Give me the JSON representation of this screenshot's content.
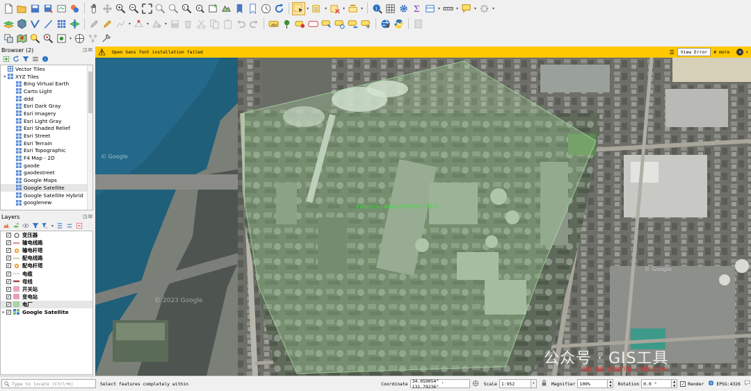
{
  "browser": {
    "title": "Browser (2)",
    "controls": "◳☒",
    "items": [
      {
        "label": "Vector Tiles",
        "expanded": false,
        "indent": 0,
        "icon": "vector-tiles-icon"
      },
      {
        "label": "XYZ Tiles",
        "expanded": true,
        "indent": 0,
        "icon": "xyz-tiles-icon"
      },
      {
        "label": "Bing Virtual Earth",
        "indent": 1,
        "icon": "tile-icon"
      },
      {
        "label": "Carto Light",
        "indent": 1,
        "icon": "tile-icon"
      },
      {
        "label": "ddd",
        "indent": 1,
        "icon": "tile-icon"
      },
      {
        "label": "Esri Dark Gray",
        "indent": 1,
        "icon": "tile-icon"
      },
      {
        "label": "Esri Imagery",
        "indent": 1,
        "icon": "tile-icon"
      },
      {
        "label": "Esri Light Gray",
        "indent": 1,
        "icon": "tile-icon"
      },
      {
        "label": "Esri Shaded Relief",
        "indent": 1,
        "icon": "tile-icon"
      },
      {
        "label": "Esri Street",
        "indent": 1,
        "icon": "tile-icon"
      },
      {
        "label": "Esri Terrain",
        "indent": 1,
        "icon": "tile-icon"
      },
      {
        "label": "Esri Topographic",
        "indent": 1,
        "icon": "tile-icon"
      },
      {
        "label": "F4 Map - 2D",
        "indent": 1,
        "icon": "tile-icon"
      },
      {
        "label": "gaode",
        "indent": 1,
        "icon": "tile-icon"
      },
      {
        "label": "gaodestreet",
        "indent": 1,
        "icon": "tile-icon"
      },
      {
        "label": "Google Maps",
        "indent": 1,
        "icon": "tile-icon"
      },
      {
        "label": "Google Satellite",
        "indent": 1,
        "icon": "tile-icon",
        "selected": true
      },
      {
        "label": "Google Satellite Hybrid",
        "indent": 1,
        "icon": "tile-icon"
      },
      {
        "label": "googlenew",
        "indent": 1,
        "icon": "tile-icon"
      }
    ]
  },
  "layers": {
    "title": "Layers",
    "controls": "◳☒",
    "items": [
      {
        "label": "变压器",
        "symbol": "point-circle",
        "color": "#ffffff",
        "stroke": "#333333"
      },
      {
        "label": "输电线路",
        "symbol": "line",
        "color": "#c0392b"
      },
      {
        "label": "输电杆塔",
        "symbol": "point-dot",
        "color": "#f0a030"
      },
      {
        "label": "配电线路",
        "symbol": "line",
        "color": "#8fbc5a"
      },
      {
        "label": "配电杆塔",
        "symbol": "point-dot",
        "color": "#f0a030"
      },
      {
        "label": "电缆",
        "symbol": "dash-line",
        "color": "#a0a0a0"
      },
      {
        "label": "母线",
        "symbol": "thick-line",
        "color": "#a04040"
      },
      {
        "label": "开关站",
        "symbol": "fill",
        "color": "#f4a0c0"
      },
      {
        "label": "变电站",
        "symbol": "fill",
        "color": "#f09ab8"
      },
      {
        "label": "电厂",
        "symbol": "fill",
        "color": "#a8d8a0",
        "selected": true
      },
      {
        "label": "Google Satellite",
        "symbol": "raster",
        "color": "#3a7bd5",
        "expand": true
      }
    ]
  },
  "message_bar": {
    "text": "Open Sans font installation failed",
    "view_error": "View Error",
    "more": "# more",
    "color": "#ffc800"
  },
  "map": {
    "plant_label": "Industrial Area of Power Plant",
    "watermark_google_1": "© Google",
    "watermark_google_2": "© 2023 Google",
    "watermark_google_3": "© Google",
    "brand_watermark": "公众号 · GIS工具",
    "red_watermark": "测绘 资源 文档快下载 • 微信:22050",
    "overlay_color": "#a8d8a0"
  },
  "status": {
    "locate_placeholder": "Type to locate (Ctrl+K)",
    "message": "Select features completely within",
    "coordinate_label": "Coordinate",
    "coordinate": "34.059054° , 131.79236°",
    "scale_label": "Scale",
    "scale": "1:952",
    "magnifier_label": "Magnifier",
    "magnifier": "100%",
    "rotation_label": "Rotation",
    "rotation": "0.0 °",
    "render_label": "Render",
    "crs": "EPSG:4326"
  }
}
